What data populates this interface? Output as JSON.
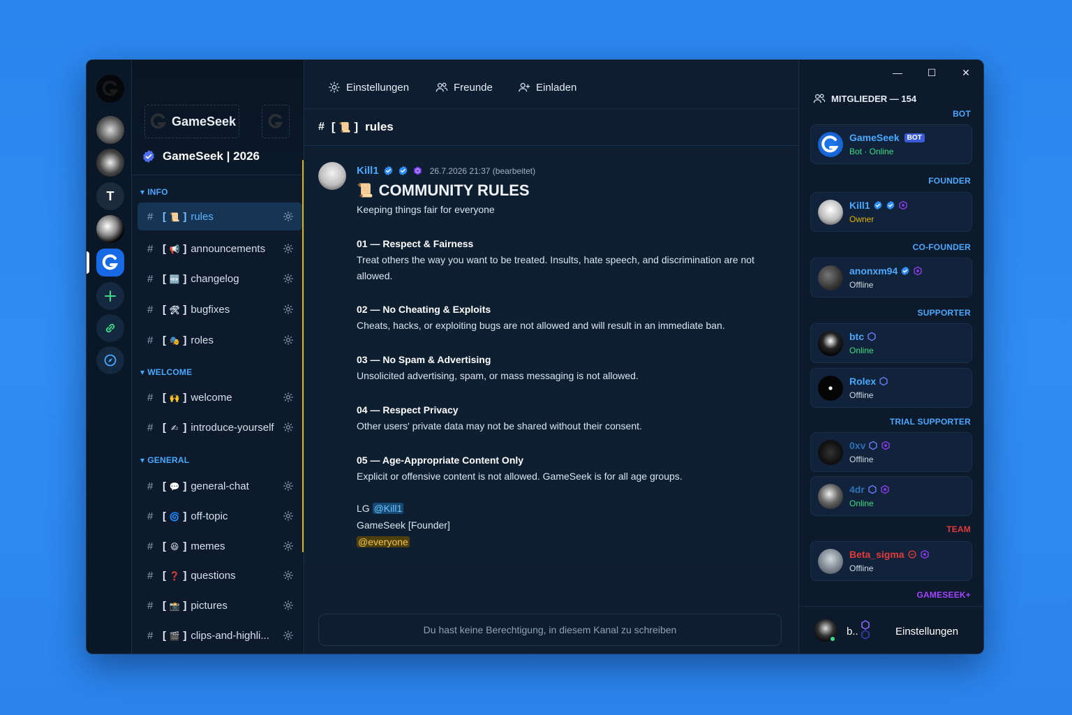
{
  "server": {
    "banner_logo_text": "GameSeek",
    "title": "GameSeek | 2026",
    "rail_letter": "T"
  },
  "categories": [
    {
      "label": "INFO"
    },
    {
      "label": "WELCOME"
    },
    {
      "label": "GENERAL"
    }
  ],
  "channels": [
    {
      "name": "rules",
      "emoji": "📜"
    },
    {
      "name": "announcements",
      "emoji": "📢"
    },
    {
      "name": "changelog",
      "emoji": "🆕"
    },
    {
      "name": "bugfixes",
      "emoji": "🛠"
    },
    {
      "name": "roles",
      "emoji": "🎭"
    },
    {
      "name": "welcome",
      "emoji": "🙌"
    },
    {
      "name": "introduce-yourself",
      "emoji": "✍"
    },
    {
      "name": "general-chat",
      "emoji": "💬"
    },
    {
      "name": "off-topic",
      "emoji": "🌀"
    },
    {
      "name": "memes",
      "emoji": "😆"
    },
    {
      "name": "questions",
      "emoji": "❓"
    },
    {
      "name": "pictures",
      "emoji": "📸"
    },
    {
      "name": "clips-and-highli...",
      "emoji": "🎬"
    }
  ],
  "topnav": {
    "settings": "Einstellungen",
    "friends": "Freunde",
    "invite": "Einladen"
  },
  "channel_header": {
    "hash": "#",
    "emoji": "📜",
    "name": "rules"
  },
  "message": {
    "author": "Kill1",
    "timestamp": "26.7.2026 21:37 (bearbeitet)",
    "title_emoji": "📜",
    "title": "COMMUNITY RULES",
    "subtitle": "Keeping things fair for everyone",
    "rules": [
      {
        "title": "01 — Respect & Fairness",
        "text": "Treat others the way you want to be treated. Insults, hate speech, and discrimination are not allowed."
      },
      {
        "title": "02 — No Cheating & Exploits",
        "text": "Cheats, hacks, or exploiting bugs are not allowed and will result in an immediate ban."
      },
      {
        "title": "03 — No Spam & Advertising",
        "text": "Unsolicited advertising, spam, or mass messaging is not allowed."
      },
      {
        "title": "04 — Respect Privacy",
        "text": "Other users' private data may not be shared without their consent."
      },
      {
        "title": "05 — Age-Appropriate Content Only",
        "text": "Explicit or offensive content is not allowed. GameSeek is for all age groups."
      }
    ],
    "sig_prefix": "LG",
    "sig_mention": "@Kill1",
    "sig_line2": "GameSeek [Founder]",
    "sig_everyone": "@everyone"
  },
  "composer": {
    "no_permission": "Du hast keine Berechtigung, in diesem Kanal zu schreiben"
  },
  "members": {
    "header": "MITGLIEDER — 154",
    "groups": [
      {
        "role": "BOT",
        "color": "#4aa8ff"
      },
      {
        "role": "FOUNDER",
        "color": "#4aa8ff"
      },
      {
        "role": "CO-FOUNDER",
        "color": "#4aa8ff"
      },
      {
        "role": "SUPPORTER",
        "color": "#4aa8ff"
      },
      {
        "role": "TRIAL SUPPORTER",
        "color": "#4aa8ff"
      },
      {
        "role": "TEAM",
        "color": "#e23b3b"
      },
      {
        "role": "GAMESEEK+",
        "color": "#a445ff"
      }
    ],
    "list": [
      {
        "name": "GameSeek",
        "badge": "BOT",
        "status": "Bot · Online",
        "status_color": "#3ddc84",
        "name_color": "#4aa8ff"
      },
      {
        "name": "Kill1",
        "status": "Owner",
        "status_color": "#e0b400",
        "name_color": "#4aa8ff"
      },
      {
        "name": "anonxm94",
        "status": "Offline",
        "status_color": "#cfd9e4",
        "name_color": "#4aa8ff"
      },
      {
        "name": "btc",
        "status": "Online",
        "status_color": "#3ddc84",
        "name_color": "#4aa8ff"
      },
      {
        "name": "Rolex",
        "status": "Offline",
        "status_color": "#cfd9e4",
        "name_color": "#4aa8ff"
      },
      {
        "name": "0xv",
        "status": "Offline",
        "status_color": "#cfd9e4",
        "name_color": "#2f6fb8"
      },
      {
        "name": "4dr",
        "status": "Online",
        "status_color": "#3ddc84",
        "name_color": "#2f6fb8"
      },
      {
        "name": "Beta_sigma",
        "status": "Offline",
        "status_color": "#cfd9e4",
        "name_color": "#e23b3b"
      }
    ]
  },
  "footer": {
    "username": "b..",
    "settings": "Einstellungen"
  },
  "window_controls": {
    "minimize": "—",
    "maximize": "☐",
    "close": "✕"
  }
}
